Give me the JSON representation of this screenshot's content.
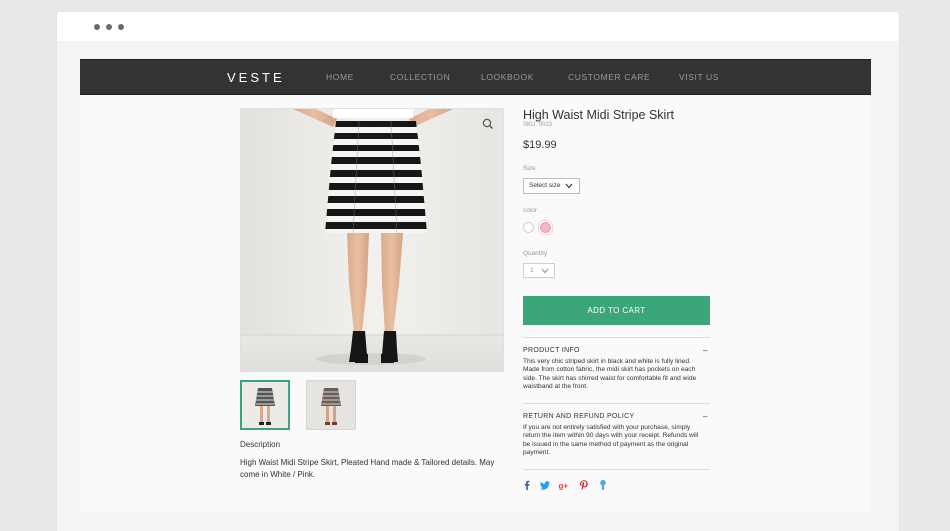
{
  "site": {
    "logo": "VESTE",
    "nav": [
      "HOME",
      "COLLECTION",
      "LOOKBOOK",
      "CUSTOMER CARE",
      "VISIT US"
    ]
  },
  "product": {
    "title": "High Waist Midi Stripe Skirt",
    "sku": "SKU: 0023",
    "price": "$19.99",
    "size_label": "Size",
    "size_value": "Select size",
    "color_label": "color",
    "colors": [
      "#ffffff",
      "#f4b6c2"
    ],
    "quantity_label": "Quantity",
    "quantity_value": "1",
    "add_to_cart": "ADD TO CART",
    "description_label": "Description",
    "description": "High Waist Midi Stripe Skirt, Pleated Hand made & Tailored details. May come in White / Pink.",
    "product_info_title": "PRODUCT INFO",
    "product_info_text": "This very chic striped skirt in black and white is fully lined. Made from cotton fabric, the midi skirt has pockets on each side. The skirt has shirred waist for comfortable fit and wide waistband at the front.",
    "return_title": "RETURN AND REFUND POLICY",
    "return_text": "If you are not entirely satisfied with your purchase, simply return the item within 90 days with your receipt. Refunds will be issued in the same method of payment as the original payment.",
    "toggle_symbol": "–"
  },
  "colors": {
    "accent": "#3aa679",
    "nav_bg": "#333333"
  },
  "social_icons": [
    "facebook-icon",
    "twitter-icon",
    "google-plus-icon",
    "pinterest-icon",
    "fancy-icon"
  ]
}
